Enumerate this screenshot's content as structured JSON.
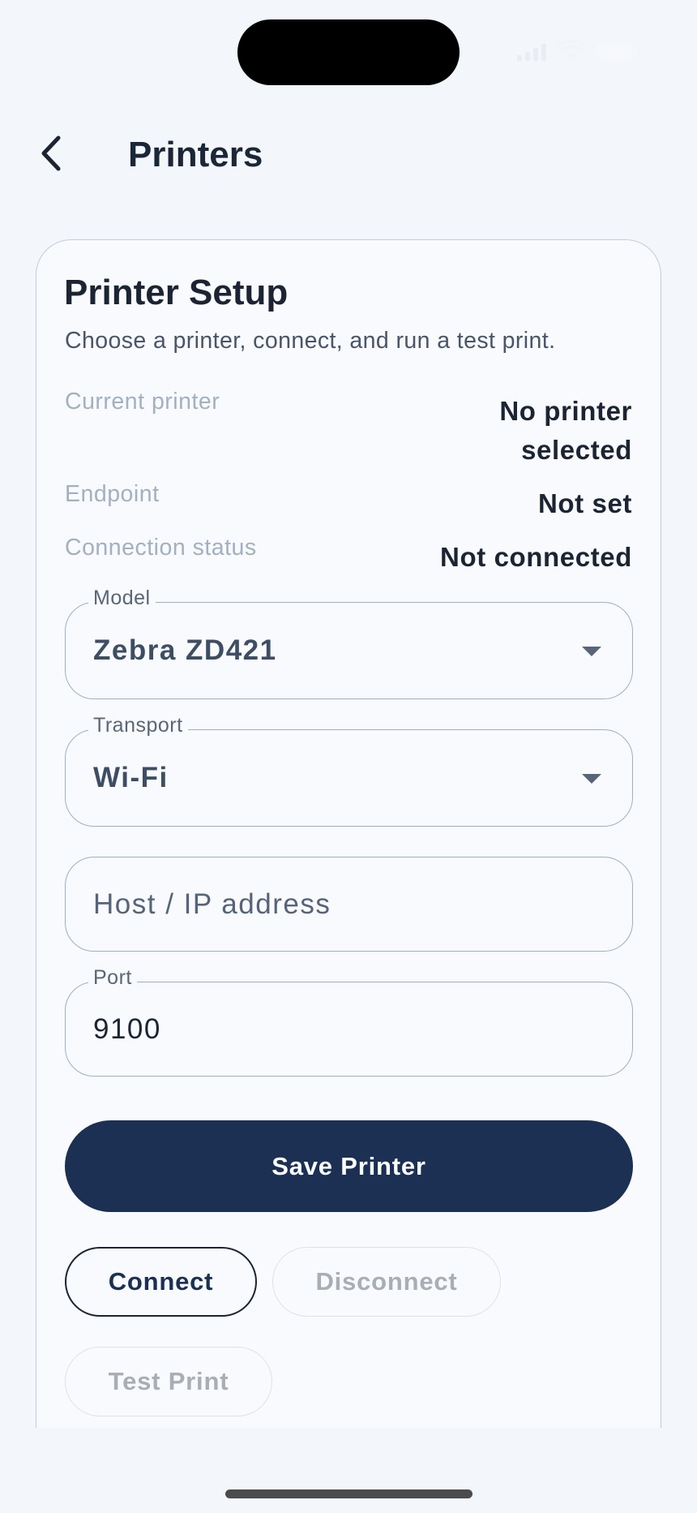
{
  "status_bar": {
    "time": "21:32"
  },
  "nav": {
    "title": "Printers",
    "back_icon": "chevron-left-icon"
  },
  "card": {
    "title": "Printer Setup",
    "subtitle": "Choose a printer, connect, and run a test print.",
    "info": [
      {
        "label": "Current printer",
        "value_line1": "No printer",
        "value_line2": "selected"
      },
      {
        "label": "Endpoint",
        "value": "Not set"
      },
      {
        "label": "Connection status",
        "value": "Not connected"
      }
    ],
    "fields": {
      "model": {
        "label": "Model",
        "value": "Zebra ZD421"
      },
      "transport": {
        "label": "Transport",
        "value": "Wi-Fi"
      },
      "host": {
        "placeholder": "Host / IP address"
      },
      "port": {
        "label": "Port",
        "value": "9100"
      }
    },
    "buttons": {
      "save": "Save Printer",
      "connect": "Connect",
      "disconnect": "Disconnect",
      "test_print": "Test Print"
    }
  },
  "colors": {
    "background": "#f3f6fb",
    "primary": "#1b3052",
    "disabled_text": "#a9aeb6"
  }
}
